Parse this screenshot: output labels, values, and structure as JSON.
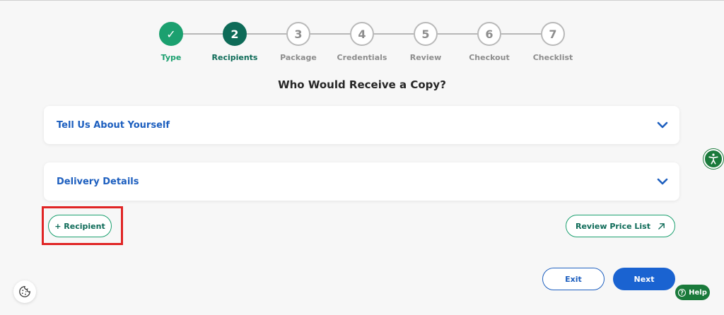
{
  "stepper": {
    "steps": [
      {
        "marker": "✓",
        "label": "Type",
        "state": "done"
      },
      {
        "marker": "2",
        "label": "Recipients",
        "state": "current"
      },
      {
        "marker": "3",
        "label": "Package",
        "state": "upcoming"
      },
      {
        "marker": "4",
        "label": "Credentials",
        "state": "upcoming"
      },
      {
        "marker": "5",
        "label": "Review",
        "state": "upcoming"
      },
      {
        "marker": "6",
        "label": "Checkout",
        "state": "upcoming"
      },
      {
        "marker": "7",
        "label": "Checklist",
        "state": "upcoming"
      }
    ]
  },
  "page": {
    "title": "Who Would Receive a Copy?"
  },
  "sections": {
    "about": {
      "title": "Tell Us About Yourself",
      "icon": "chevron-down-icon"
    },
    "delivery": {
      "title": "Delivery Details",
      "icon": "chevron-down-icon"
    }
  },
  "actions": {
    "add_recipient": "+ Recipient",
    "review_price_list": "Review Price List",
    "exit": "Exit",
    "next": "Next"
  },
  "widgets": {
    "help": "Help",
    "help_icon": "?",
    "accessibility_icon": "accessibility-icon",
    "cookie_icon": "cookie-icon"
  },
  "colors": {
    "done": "#1ba06f",
    "current": "#0e6b58",
    "link_blue": "#1d5fbf",
    "primary_button": "#1a63d1",
    "highlight": "#e02424"
  }
}
